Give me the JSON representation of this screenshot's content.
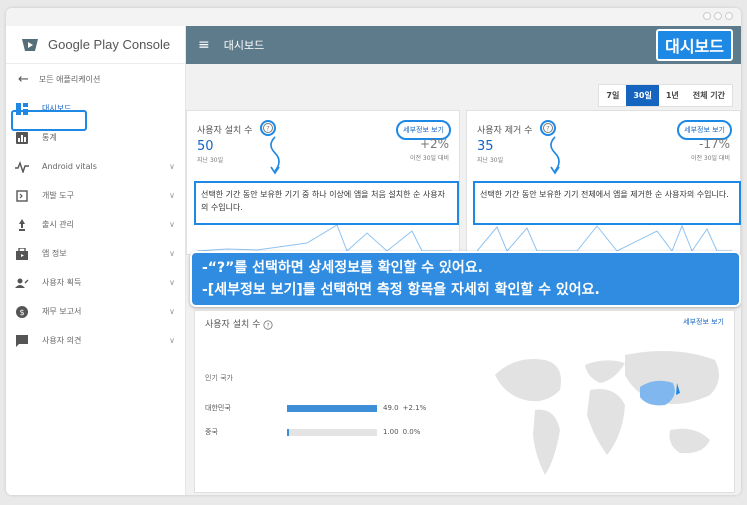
{
  "brand": {
    "google_play": "Google Play",
    "console": "Console"
  },
  "sidebar": {
    "back_label": "모든 애플리케이션",
    "items": [
      {
        "label": "대시보드",
        "icon": "dashboard-icon",
        "has_chevron": false
      },
      {
        "label": "통계",
        "icon": "stats-icon",
        "has_chevron": false
      },
      {
        "label": "Android vitals",
        "icon": "vitals-icon",
        "has_chevron": true
      },
      {
        "label": "개발 도구",
        "icon": "dev-tools-icon",
        "has_chevron": true
      },
      {
        "label": "출시 관리",
        "icon": "release-icon",
        "has_chevron": true
      },
      {
        "label": "앱 정보",
        "icon": "store-icon",
        "has_chevron": true
      },
      {
        "label": "사용자 획득",
        "icon": "user-acquisition-icon",
        "has_chevron": true
      },
      {
        "label": "재무 보고서",
        "icon": "finance-icon",
        "has_chevron": true
      },
      {
        "label": "사용자 의견",
        "icon": "feedback-icon",
        "has_chevron": true
      }
    ]
  },
  "header": {
    "title": "대시보드",
    "badge": "대시보드"
  },
  "range_buttons": [
    "7일",
    "30일",
    "1년",
    "전체 기간"
  ],
  "range_selected": "30일",
  "cards": {
    "installs": {
      "title": "사용자 설치 수",
      "detail": "세부정보 보기",
      "value": "50",
      "period": "지난 30일",
      "change": "+2%",
      "change_sub": "이전 30일 대비",
      "tooltip": "선택한 기간 동안 보유한 기기 중 하나 이상에 앱을 처음 설치한 순 사용자의 수입니다.",
      "chart_tick": "4"
    },
    "uninstalls": {
      "title": "사용자 제거 수",
      "detail": "세부정보 보기",
      "value": "35",
      "period": "지난 30일",
      "change": "-17%",
      "change_sub": "이전 30일 대비",
      "tooltip": "선택한 기간 동안 보유한 기기 전체에서 앱을 제거한 순 사용자의 수입니다.",
      "chart_tick": "3"
    }
  },
  "banner": {
    "line1": "-“?”를 선택하면 상세정보를 확인할 수 있어요.",
    "line2": "-[세부정보 보기]를 선택하면 측정 항목을 자세히 확인할 수 있어요."
  },
  "map_card": {
    "title": "사용자 설치 수",
    "detail": "세부정보 보기",
    "popular_label": "인기 국가",
    "countries": [
      {
        "name": "대한민국",
        "value": "49.0",
        "change": "+2.1%",
        "fraction": 1.0
      },
      {
        "name": "중국",
        "value": "1.00",
        "change": "0.0%",
        "fraction": 0.02
      }
    ]
  },
  "colors": {
    "accent": "#1e88e5",
    "appbar": "#5e7b8c",
    "selected": "#1565c0"
  }
}
